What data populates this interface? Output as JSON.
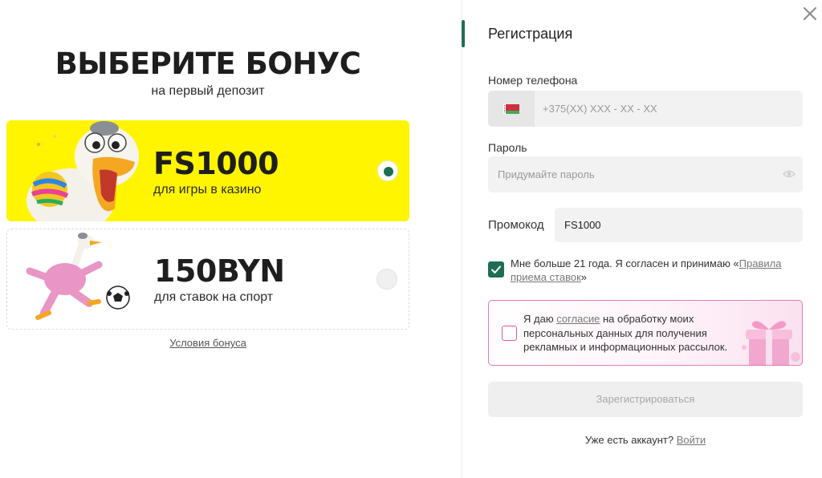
{
  "bonus": {
    "title": "ВЫБЕРИТЕ БОНУС",
    "subtitle": "на первый депозит",
    "options": [
      {
        "amount": "FS1000",
        "description": "для игры в казино",
        "selected": true,
        "background": "#fff500"
      },
      {
        "amount": "150BYN",
        "description": "для ставок на спорт",
        "selected": false,
        "background": "#ffffff"
      }
    ],
    "terms_link": "Условия бонуса"
  },
  "registration": {
    "title": "Регистрация",
    "phone": {
      "label": "Номер телефона",
      "placeholder": "+375(XX) XXX - XX - XX",
      "value": "",
      "country_flag": "belarus-flag-icon"
    },
    "password": {
      "label": "Пароль",
      "placeholder": "Придумайте пароль",
      "value": ""
    },
    "promo": {
      "label": "Промокод",
      "value": "FS1000"
    },
    "age_agreement": {
      "checked": true,
      "text_before": "Мне больше 21 года. Я согласен и принимаю «",
      "link": "Правила приема ставок",
      "text_after": "»"
    },
    "marketing_consent": {
      "checked": false,
      "text_before": "Я даю ",
      "link": "согласие",
      "text_after": " на обработку моих персональных данных для получения рекламных и информационных рассылок."
    },
    "submit_label": "Зарегистрироваться",
    "login_prompt": "Уже есть аккаунт?",
    "login_link": "Войти"
  },
  "colors": {
    "accent": "#1f6e52",
    "casino_card": "#fff500",
    "consent_border": "#e07cb6"
  }
}
